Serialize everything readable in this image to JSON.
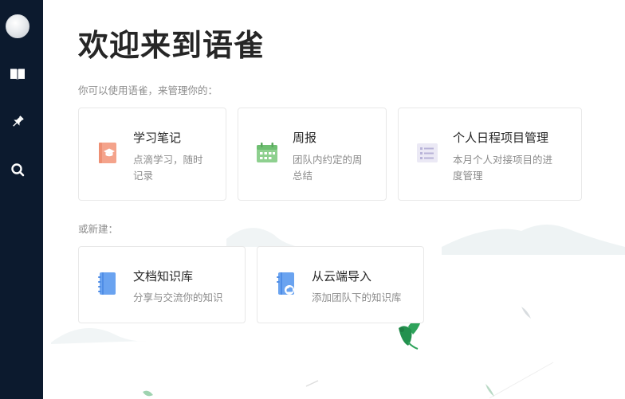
{
  "sidebar": {
    "items": [
      {
        "icon": "book-icon"
      },
      {
        "icon": "pin-icon"
      },
      {
        "icon": "search-icon"
      }
    ]
  },
  "main": {
    "title": "欢迎来到语雀",
    "subtitle": "你可以使用语雀，来管理你的：",
    "templates": [
      {
        "title": "学习笔记",
        "desc_lines": [
          "点滴学习，随时",
          "记录"
        ],
        "icon": "notebook-icon",
        "color": "#f4a38b"
      },
      {
        "title": "周报",
        "desc_lines": [
          "团队内约定的周",
          "总结"
        ],
        "icon": "calendar-icon",
        "color": "#8ed08f"
      },
      {
        "title": "个人日程项目管理",
        "desc_lines": [
          "本月个人对接项目的进",
          "度管理"
        ],
        "icon": "checklist-icon",
        "color": "#b8b3d8"
      }
    ],
    "new_label": "或新建：",
    "create": [
      {
        "title": "文档知识库",
        "desc": "分享与交流你的知识",
        "icon": "knowledge-base-icon",
        "color": "#6aa3f0"
      },
      {
        "title": "从云端导入",
        "desc": "添加团队下的知识库",
        "icon": "cloud-import-icon",
        "color": "#6aa3f0"
      }
    ]
  }
}
